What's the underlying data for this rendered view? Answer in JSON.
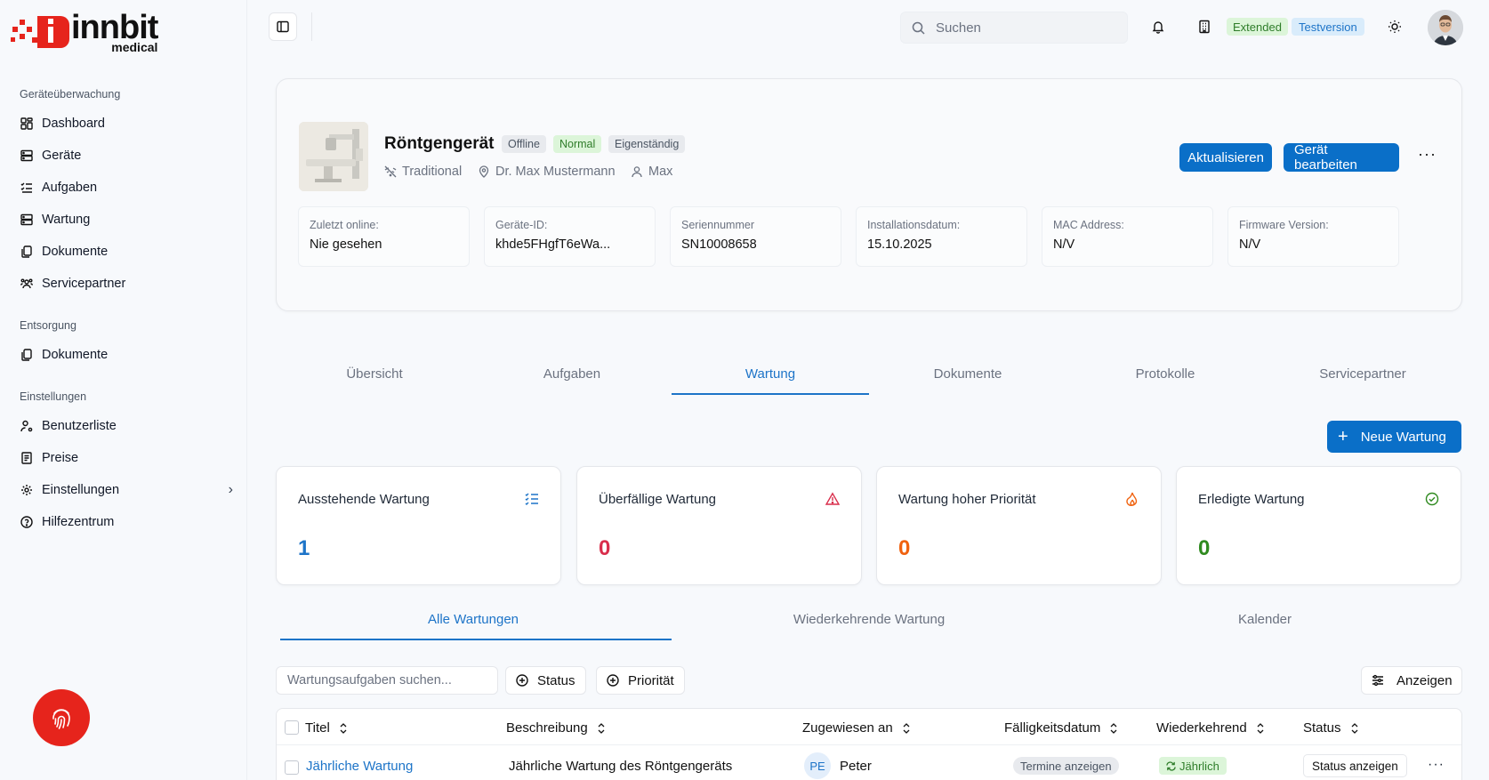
{
  "brand": {
    "name": "innbit",
    "sub": "medical",
    "color": "#e6241c"
  },
  "sidebar": {
    "sections": [
      {
        "title": "Geräteüberwachung"
      },
      {
        "title": "Entsorgung"
      },
      {
        "title": "Einstellungen"
      }
    ],
    "items": [
      {
        "label": "Dashboard",
        "icon": "dashboard-icon"
      },
      {
        "label": "Geräte",
        "icon": "server-icon"
      },
      {
        "label": "Aufgaben",
        "icon": "list-check-icon"
      },
      {
        "label": "Wartung",
        "icon": "server-icon"
      },
      {
        "label": "Dokumente",
        "icon": "documents-icon"
      },
      {
        "label": "Servicepartner",
        "icon": "users-icon"
      },
      {
        "label": "Dokumente",
        "icon": "documents-icon"
      },
      {
        "label": "Benutzerliste",
        "icon": "user-settings-icon"
      },
      {
        "label": "Preise",
        "icon": "receipt-icon"
      },
      {
        "label": "Einstellungen",
        "icon": "gear-icon"
      },
      {
        "label": "Hilfezentrum",
        "icon": "help-icon"
      }
    ]
  },
  "topbar": {
    "search_placeholder": "Suchen",
    "badge_extended": "Extended",
    "badge_test": "Testversion"
  },
  "device": {
    "title": "Röntgengerät",
    "tags": [
      "Offline",
      "Normal",
      "Eigenständig"
    ],
    "type": "Traditional",
    "location": "Dr. Max Mustermann",
    "owner": "Max",
    "refresh_label": "Aktualisieren",
    "edit_label": "Gerät bearbeiten",
    "info": [
      {
        "label": "Zuletzt online:",
        "value": "Nie gesehen"
      },
      {
        "label": "Geräte-ID:",
        "value": "khde5FHgfT6eWa..."
      },
      {
        "label": "Seriennummer",
        "value": "SN10008658"
      },
      {
        "label": "Installationsdatum:",
        "value": "15.10.2025"
      },
      {
        "label": "MAC Address:",
        "value": "N/V"
      },
      {
        "label": "Firmware Version:",
        "value": "N/V"
      }
    ]
  },
  "tabs": [
    "Übersicht",
    "Aufgaben",
    "Wartung",
    "Dokumente",
    "Protokolle",
    "Servicepartner"
  ],
  "new_button": "Neue Wartung",
  "stats": [
    {
      "title": "Ausstehende Wartung",
      "value": "1",
      "color": "#1d74c8"
    },
    {
      "title": "Überfällige Wartung",
      "value": "0",
      "color": "#d92d4b"
    },
    {
      "title": "Wartung hoher Priorität",
      "value": "0",
      "color": "#f0620f"
    },
    {
      "title": "Erledigte Wartung",
      "value": "0",
      "color": "#2f8a1f"
    }
  ],
  "subtabs": [
    "Alle Wartungen",
    "Wiederkehrende Wartung",
    "Kalender"
  ],
  "filters": {
    "search_placeholder": "Wartungsaufgaben suchen...",
    "status": "Status",
    "priority": "Priorität",
    "view": "Anzeigen"
  },
  "table": {
    "columns": [
      "Titel",
      "Beschreibung",
      "Zugewiesen an",
      "Fälligkeitsdatum",
      "Wiederkehrend",
      "Status"
    ],
    "rows": [
      {
        "title": "Jährliche Wartung",
        "description": "Jährliche Wartung des Röntgengeräts",
        "assignee_initials": "PE",
        "assignee": "Peter",
        "due": "Termine anzeigen",
        "recurring": "Jährlich",
        "status": "Status anzeigen"
      }
    ]
  }
}
